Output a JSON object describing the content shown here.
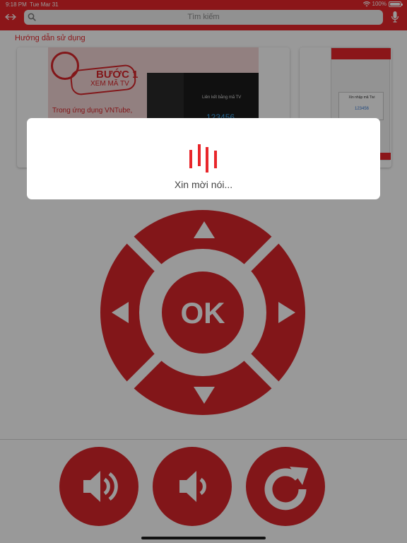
{
  "status_bar": {
    "time": "9:18 PM",
    "date": "Tue Mar 31",
    "battery": "100%"
  },
  "header": {
    "search_placeholder": "Tìm kiếm",
    "accent_color": "#e8262b"
  },
  "guide": {
    "section_title": "Hướng dẫn sử dụng",
    "card1": {
      "step_number": "BƯỚC 1",
      "step_subtitle": "XEM MÃ TV",
      "step_text": "Trong ứng dụng VNTube,",
      "tv_title": "Liên kết bằng mã TV",
      "tv_code": "123456"
    },
    "card2": {
      "dialog_title": "Xin nhập mã Tivi",
      "dialog_code": "123456"
    }
  },
  "remote": {
    "ok_label": "OK",
    "button_color": "#d9262b",
    "icons": [
      "arrow-up-icon",
      "arrow-down-icon",
      "arrow-left-icon",
      "arrow-right-icon",
      "volume-up-icon",
      "volume-down-icon",
      "refresh-icon"
    ]
  },
  "voice_dialog": {
    "message": "Xin mời nói..."
  }
}
